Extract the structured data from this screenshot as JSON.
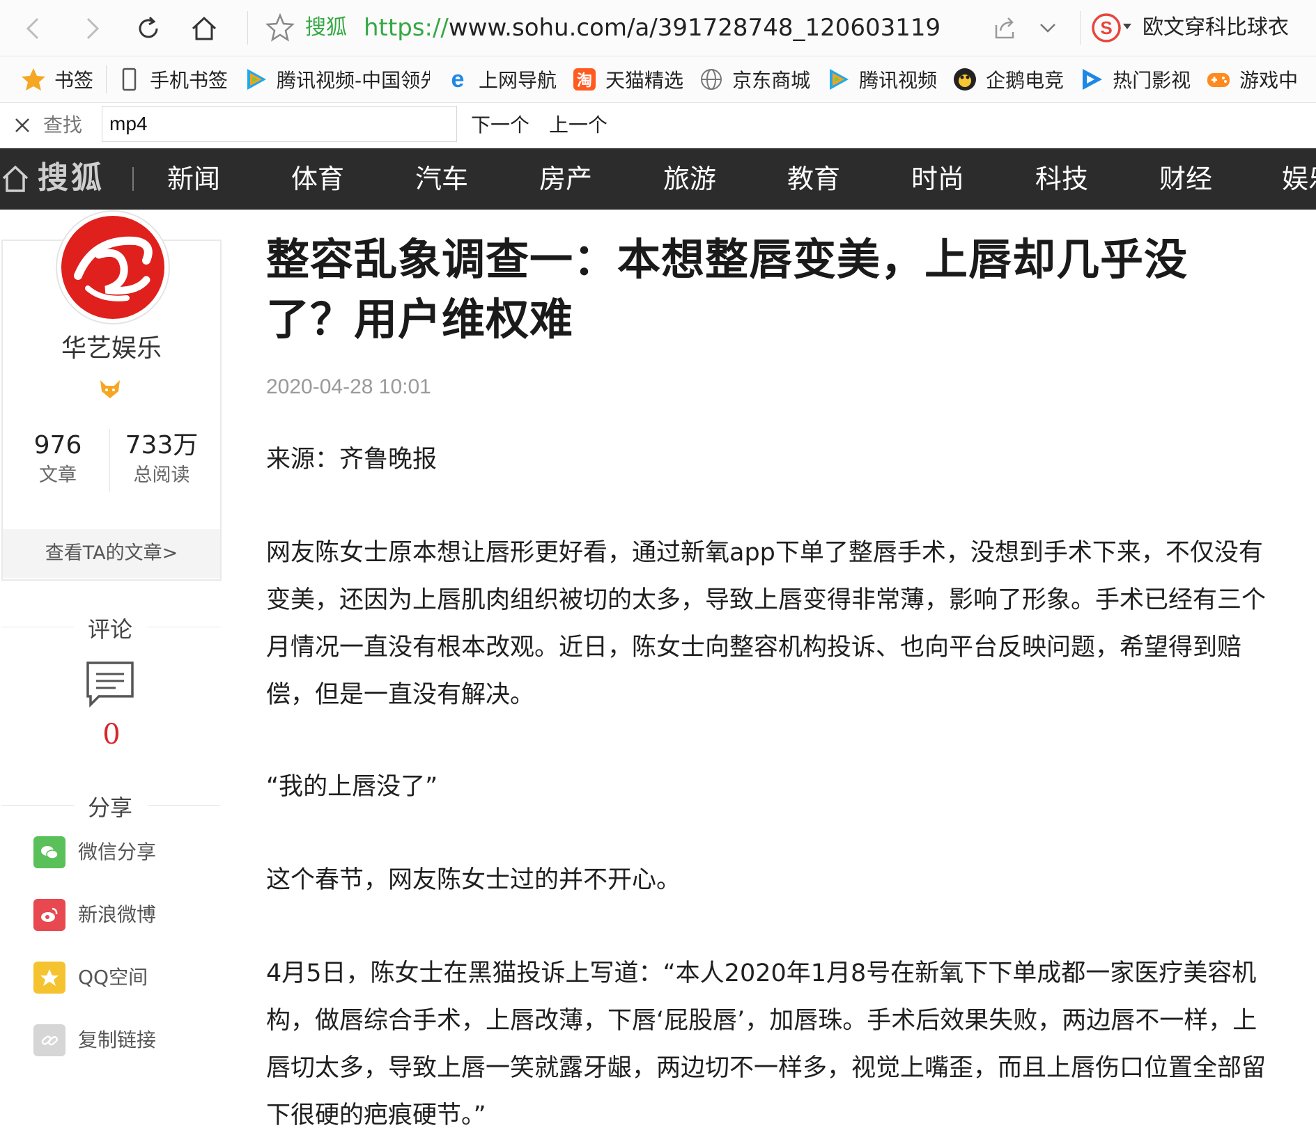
{
  "browser": {
    "site_name": "搜狐",
    "url_protocol": "https://",
    "url_rest": "www.sohu.com/a/391728748_120603119",
    "search_suggestion": "欧文穿科比球衣"
  },
  "bookmarks": [
    {
      "label": "书签",
      "icon": "star-icon"
    },
    {
      "label": "手机书签",
      "icon": "phone-icon"
    },
    {
      "label": "腾讯视频-中国领先",
      "icon": "tencent-video-icon"
    },
    {
      "label": "上网导航",
      "icon": "ie-icon"
    },
    {
      "label": "天猫精选",
      "icon": "taobao-icon"
    },
    {
      "label": "京东商城",
      "icon": "globe-icon"
    },
    {
      "label": "腾讯视频",
      "icon": "tencent-video-icon"
    },
    {
      "label": "企鹅电竞",
      "icon": "penguin-icon"
    },
    {
      "label": "热门影视",
      "icon": "play-icon"
    },
    {
      "label": "游戏中",
      "icon": "gamepad-icon"
    }
  ],
  "findbar": {
    "label": "查找",
    "value": "mp4",
    "next_label": "下一个",
    "prev_label": "上一个"
  },
  "sitenav": {
    "logo": "搜狐",
    "items": [
      "新闻",
      "体育",
      "汽车",
      "房产",
      "旅游",
      "教育",
      "时尚",
      "科技",
      "财经",
      "娱乐"
    ]
  },
  "author": {
    "name": "华艺娱乐",
    "articles_count": "976",
    "articles_label": "文章",
    "reads_count": "733万",
    "reads_label": "总阅读",
    "view_link": "查看TA的文章>"
  },
  "sidebar": {
    "comment_heading": "评论",
    "comment_count": "0",
    "share_heading": "分享",
    "share_items": [
      {
        "label": "微信分享",
        "color": "#5ac05a"
      },
      {
        "label": "新浪微博",
        "color": "#e8484f"
      },
      {
        "label": "QQ空间",
        "color": "#f5c330"
      },
      {
        "label": "复制链接",
        "color": "#cfcfcf"
      }
    ]
  },
  "article": {
    "title": "整容乱象调查一：本想整唇变美，上唇却几乎没了？用户维权难",
    "date": "2020-04-28 10:01",
    "paragraphs": [
      "来源：齐鲁晚报",
      "网友陈女士原本想让唇形更好看，通过新氧app下单了整唇手术，没想到手术下来，不仅没有变美，还因为上唇肌肉组织被切的太多，导致上唇变得非常薄，影响了形象。手术已经有三个月情况一直没有根本改观。近日，陈女士向整容机构投诉、也向平台反映问题，希望得到赔偿，但是一直没有解决。",
      "“我的上唇没了”",
      "这个春节，网友陈女士过的并不开心。",
      "4月5日，陈女士在黑猫投诉上写道：“本人2020年1月8号在新氧下下单成都一家医疗美容机构，做唇综合手术，上唇改薄，下唇‘屁股唇’，加唇珠。手术后效果失败，两边唇不一样，上唇切太多，导致上唇一笑就露牙龈，两边切不一样多，视觉上嘴歪，而且上唇伤口位置全部留下很硬的疤痕硬节。”"
    ]
  }
}
